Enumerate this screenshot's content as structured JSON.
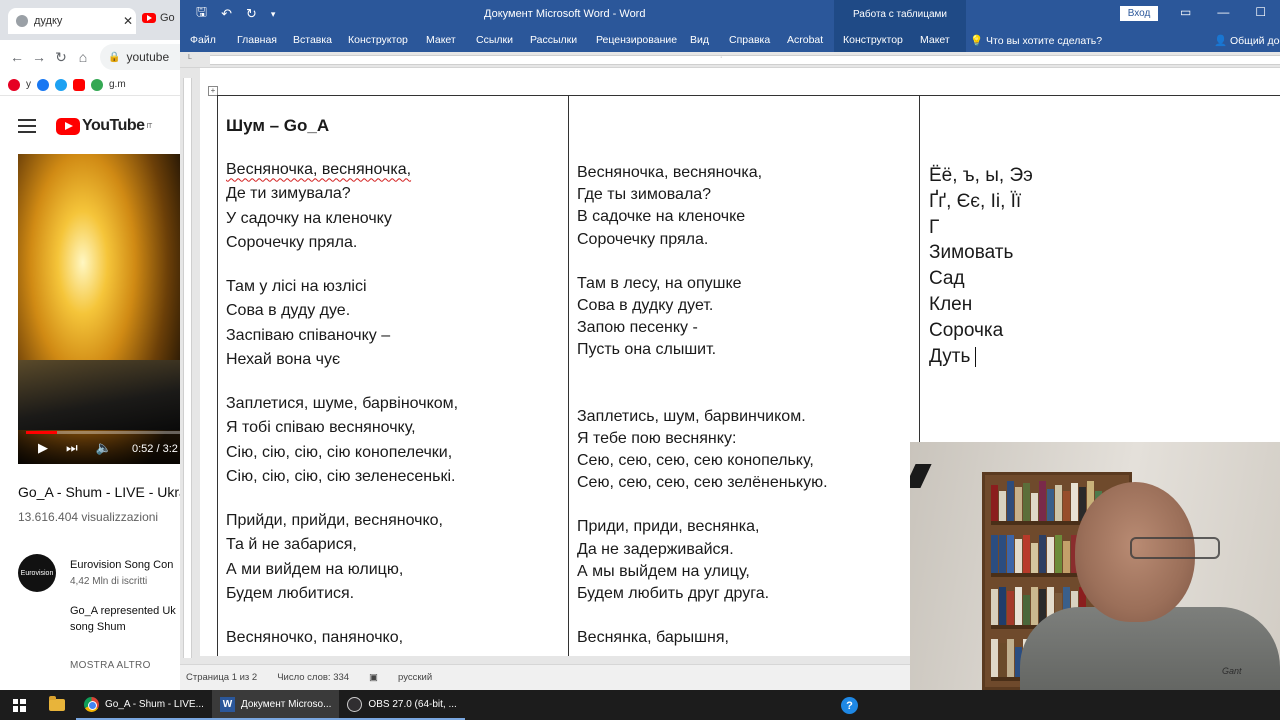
{
  "chrome": {
    "tab1_label": "дудку",
    "tab2_label": "Go",
    "url": "youtube",
    "bookmarks": [
      "у",
      "g.m"
    ],
    "yt_region": "IT",
    "video_time": "0:52 / 3:2",
    "video_title": "Go_A - Shum - LIVE - Ukra",
    "video_views": "13.616.404 visualizzazioni",
    "channel_name": "Eurovision Song Con",
    "channel_subs": "4,42 Mln di iscritti",
    "desc_line1": "Go_A represented Uk",
    "desc_line2": "song Shum",
    "show_more": "MOSTRA ALTRO",
    "avatar_text": "Eurovision"
  },
  "word": {
    "title": "Документ Microsoft Word  -  Word",
    "context_group": "Работа с таблицами",
    "login": "Вход",
    "tabs": [
      "Файл",
      "Главная",
      "Вставка",
      "Конструктор",
      "Макет",
      "Ссылки",
      "Рассылки",
      "Рецензирование",
      "Вид",
      "Справка",
      "Acrobat",
      "Конструктор",
      "Макет"
    ],
    "tell_me": "Что вы хотите сделать?",
    "share": "Общий дос",
    "status": {
      "page": "Страница 1 из 2",
      "words": "Число слов: 334",
      "lang": "русский"
    },
    "doc": {
      "title": "Шум – Go_A",
      "ukr_stanzas": [
        [
          "Весняночка, весняночка,",
          "Де ти зимувала?",
          "У садочку на кленочку",
          "Сорочечку пряла."
        ],
        [
          "Там у лісі на юзлісі",
          "Сова в дуду дуе.",
          "Заспіваю співаночку –",
          "Нехай вона чує"
        ],
        [
          "Заплетися, шуме, барвіночком,",
          "Я тобі співаю весняночку,",
          "Сію, сію, сію, сію конопелечки,",
          "Сію, сію, сію, сію зеленесенькі."
        ],
        [
          "Прийди, прийди, весняночко,",
          "Та й не забарися,",
          "А ми вийдем на юлицю,",
          "Будем любитися."
        ],
        [
          "Весняночко, паняночко,"
        ]
      ],
      "rus_stanzas": [
        [
          "Весняночка, весняночка,",
          "Где ты зимовала?",
          "В садочке на кленочке",
          "Сорочечку пряла."
        ],
        [
          "Там в лесу, на опушке",
          "Сова в дудку дует.",
          "Запою песенку -",
          "Пусть она слышит."
        ],
        [
          "Заплетись, шум, барвинчиком.",
          "Я тебе пою веснянку:",
          "Сею, сею, сею, сею конопельку,",
          "Сею, сею, сею, сею зелёненькую."
        ],
        [
          "Приди, приди, веснянка,",
          "Да не задерживайся.",
          "А мы выйдем на улицу,",
          "Будем любить друг друга."
        ],
        [
          "Веснянка, барышня,"
        ]
      ],
      "notes": [
        "Ёё, ъ, ы, Ээ",
        "Ґґ, Єє, Іі, Її",
        "Г",
        "Зимовать",
        "Сад",
        "Клен",
        "Сорочка",
        "Дуть"
      ]
    }
  },
  "taskbar": {
    "app1": "Go_A - Shum - LIVE...",
    "app2": "Документ Microso...",
    "app3": "OBS 27.0 (64-bit, ..."
  }
}
